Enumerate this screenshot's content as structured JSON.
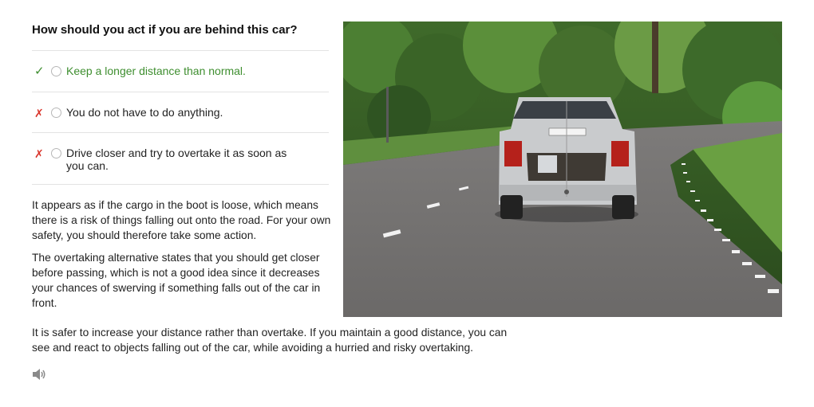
{
  "question": "How should you act if you are behind this car?",
  "answers": [
    {
      "text": "Keep a longer distance than normal.",
      "mark": "✓",
      "correct": true
    },
    {
      "text": "You do not have to do anything.",
      "mark": "✗",
      "correct": false
    },
    {
      "text": "Drive closer and try to overtake it as soon as you can.",
      "mark": "✗",
      "correct": false
    }
  ],
  "explanation": [
    "It appears as if the cargo in the boot is loose, which means there is a risk of things falling out onto the road. For your own safety, you should therefore take some action.",
    "The overtaking alternative states that you should get closer before passing, which is not a good idea since it decreases your chances of swerving if something falls out of the car in front.",
    "It is safer to increase your distance rather than overtake. If you maintain a good distance, you can see and react to objects falling out of the car, while avoiding a hurried and risky overtaking."
  ],
  "icons": {
    "audio": "speaker-icon"
  },
  "colors": {
    "correct": "#3e8e2f",
    "wrong": "#d9352b"
  }
}
